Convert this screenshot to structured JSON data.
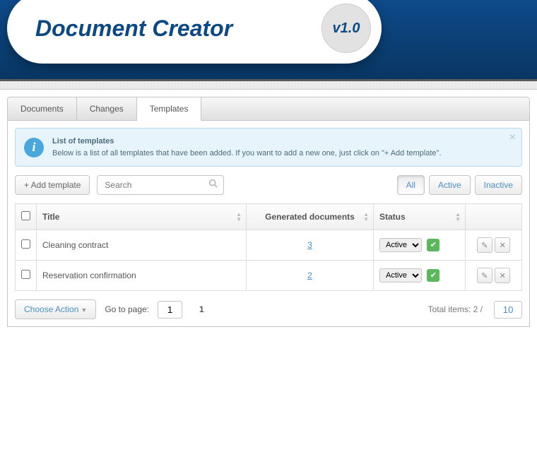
{
  "header": {
    "app_title": "Document Creator",
    "version": "v1.0"
  },
  "tabs": [
    {
      "label": "Documents",
      "active": false
    },
    {
      "label": "Changes",
      "active": false
    },
    {
      "label": "Templates",
      "active": true
    }
  ],
  "info": {
    "title": "List of templates",
    "body": "Below is a list of all templates that have been added. If you want to add a new one, just click on \"+ Add template\"."
  },
  "toolbar": {
    "add_label": "+ Add template",
    "search_placeholder": "Search",
    "filters": {
      "all": "All",
      "active": "Active",
      "inactive": "Inactive"
    }
  },
  "table": {
    "headers": {
      "title": "Title",
      "generated": "Generated documents",
      "status": "Status"
    },
    "rows": [
      {
        "title": "Cleaning contract",
        "generated": "3",
        "status": "Active"
      },
      {
        "title": "Reservation confirmation",
        "generated": "2",
        "status": "Active"
      }
    ]
  },
  "footer": {
    "choose_action": "Choose Action",
    "goto_label": "Go to page:",
    "goto_value": "1",
    "current_page": "1",
    "total_label": "Total items:",
    "total_items": "2",
    "per_page": "10"
  }
}
